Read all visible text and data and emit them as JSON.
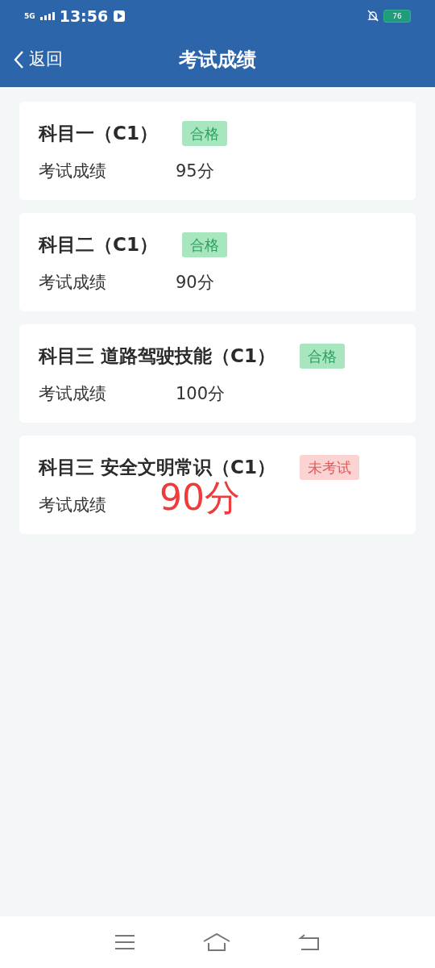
{
  "status_bar": {
    "time": "13:56",
    "network": "5G",
    "battery": "76"
  },
  "header": {
    "back": "返回",
    "title": "考试成绩"
  },
  "cards": [
    {
      "subject": "科目一（C1）",
      "badge": {
        "text": "合格",
        "kind": "pass"
      },
      "label": "考试成绩",
      "score": "95分"
    },
    {
      "subject": "科目二（C1）",
      "badge": {
        "text": "合格",
        "kind": "pass"
      },
      "label": "考试成绩",
      "score": "90分"
    },
    {
      "subject": "科目三 道路驾驶技能（C1）",
      "badge": {
        "text": "合格",
        "kind": "pass"
      },
      "label": "考试成绩",
      "score": "100分"
    },
    {
      "subject": "科目三 安全文明常识（C1）",
      "badge": {
        "text": "未考试",
        "kind": "untested"
      },
      "label": "考试成绩",
      "overlay": "90分"
    }
  ]
}
